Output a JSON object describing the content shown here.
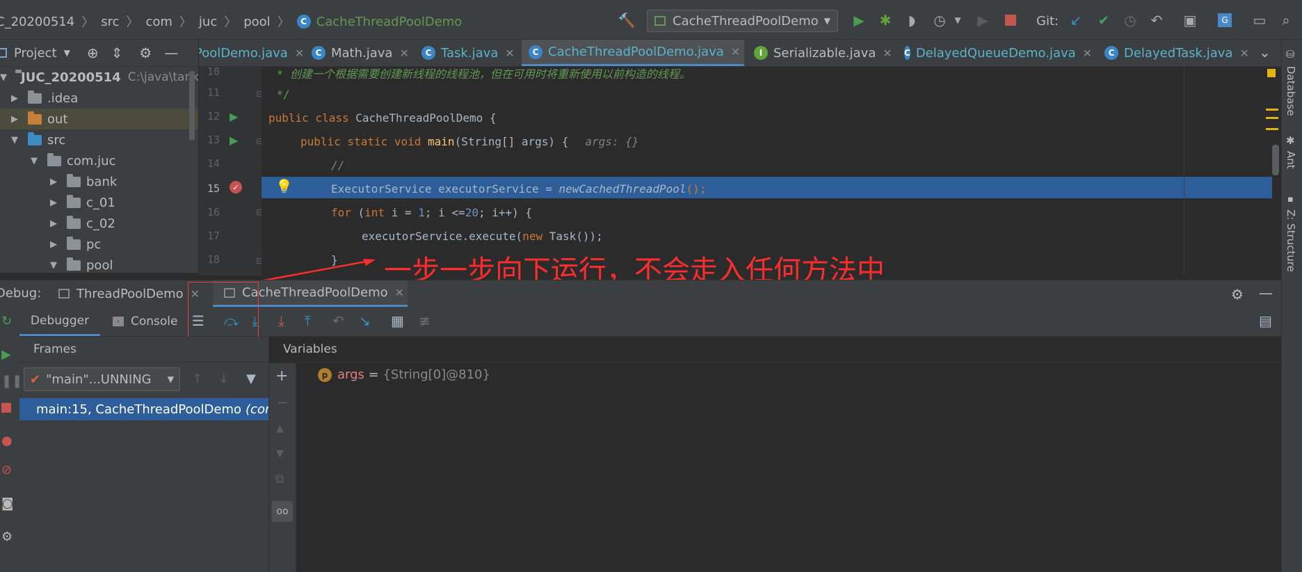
{
  "navbar": {
    "breadcrumbs": [
      "C_20200514",
      "src",
      "com",
      "juc",
      "pool",
      "CacheThreadPoolDemo"
    ],
    "run_config": "CacheThreadPoolDemo",
    "git_label": "Git:"
  },
  "project": {
    "title": "Project",
    "root": "JUC_20200514",
    "root_path": "C:\\java\\tank",
    "items": [
      ".idea",
      "out",
      "src",
      "com.juc",
      "bank",
      "c_01",
      "c_02",
      "pc",
      "pool"
    ]
  },
  "editor": {
    "tabs": [
      "PoolDemo.java",
      "Math.java",
      "Task.java",
      "CacheThreadPoolDemo.java",
      "Serializable.java",
      "DelayedQueueDemo.java",
      "DelayedTask.java"
    ],
    "active_tab": "CacheThreadPoolDemo.java",
    "line_numbers": [
      "10",
      "11",
      "12",
      "13",
      "14",
      "15",
      "16",
      "17",
      "18"
    ],
    "lines": {
      "l10": " * 创建一个根据需要创建新线程的线程池，但在可用时将重新使用以前构造的线程。",
      "l11": " */",
      "l12_kw": "public class ",
      "l12_name": "CacheThreadPoolDemo {",
      "l13_kw": "public static void ",
      "l13_fn": "main",
      "l13_rest": "(String[] args) {",
      "l13_hint": "args: {}",
      "l14": "//",
      "l15_a": "ExecutorService executorService = ",
      "l15_b": "newCachedThreadPool",
      "l15_c": "();",
      "l16_for": "for",
      "l16_a": " (",
      "l16_int": "int",
      "l16_b": " i = ",
      "l16_one": "1",
      "l16_c": "; i <=",
      "l16_twenty": "20",
      "l16_d": "; i++) {",
      "l17_a": "executorService.execute(",
      "l17_new": "new",
      "l17_b": " Task());",
      "l18": "}"
    }
  },
  "annotation": "一步一步向下运行，不会走入任何方法中",
  "right_strip": [
    "Database",
    "Ant",
    "Z: Structure"
  ],
  "debug": {
    "label": "Debug:",
    "tabs": [
      "ThreadPoolDemo",
      "CacheThreadPoolDemo"
    ],
    "subtabs": [
      "Debugger",
      "Console"
    ],
    "frames_title": "Frames",
    "variables_title": "Variables",
    "thread_select": "\"main\"...UNNING",
    "frame": "main:15, CacheThreadPoolDemo",
    "frame_pkg": "(com.juc.pool)",
    "var_name": "args",
    "var_eq": " = ",
    "var_value": "{String[0]@810}"
  }
}
